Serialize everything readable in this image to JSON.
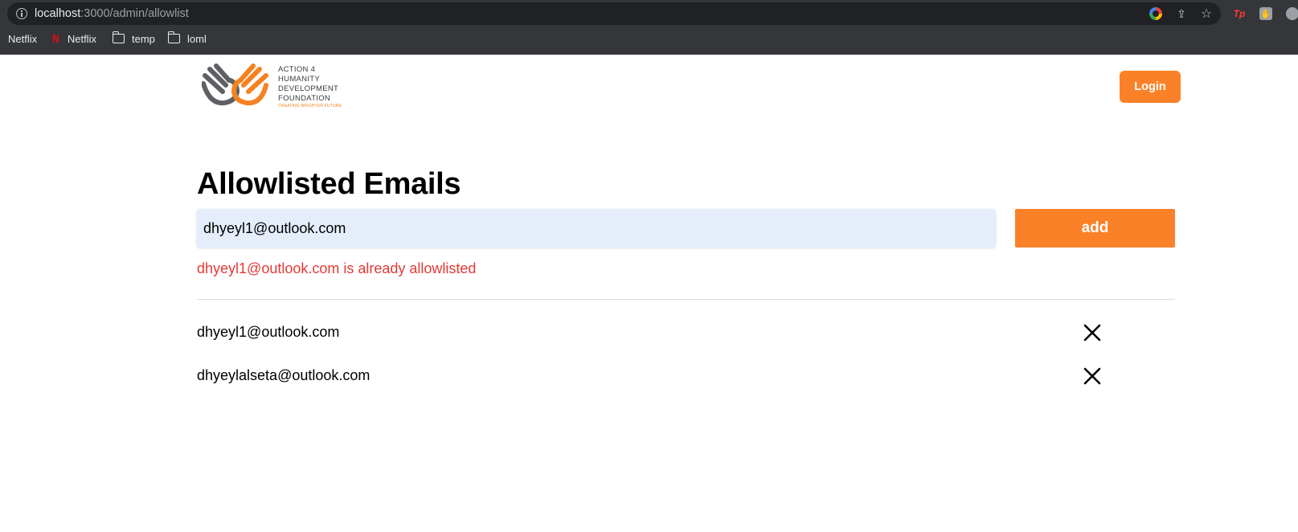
{
  "browser": {
    "url_host": "localhost",
    "url_path": ":3000/admin/allowlist",
    "bookmarks": [
      {
        "label": "Netflix",
        "icon": "none"
      },
      {
        "label": "Netflix",
        "icon": "netflix-icon"
      },
      {
        "label": "temp",
        "icon": "folder-icon"
      },
      {
        "label": "loml",
        "icon": "folder-icon"
      }
    ],
    "extensions": {
      "tp_label": "Tp"
    }
  },
  "header": {
    "logo_lines": [
      "ACTION 4",
      "HUMANITY",
      "DEVELOPMENT",
      "FOUNDATION"
    ],
    "logo_tagline": "CREATING BRIGHTER FUTURE",
    "login_label": "Login"
  },
  "main": {
    "title": "Allowlisted Emails",
    "input_value": "dhyeyl1@outlook.com",
    "add_label": "add",
    "error_message": "dhyeyl1@outlook.com is already allowlisted",
    "emails": [
      "dhyeyl1@outlook.com",
      "dhyeylalseta@outlook.com"
    ]
  },
  "colors": {
    "accent": "#fb8128",
    "error": "#e53935",
    "input_bg": "#e5edfb",
    "chrome_bg": "#35363a"
  }
}
